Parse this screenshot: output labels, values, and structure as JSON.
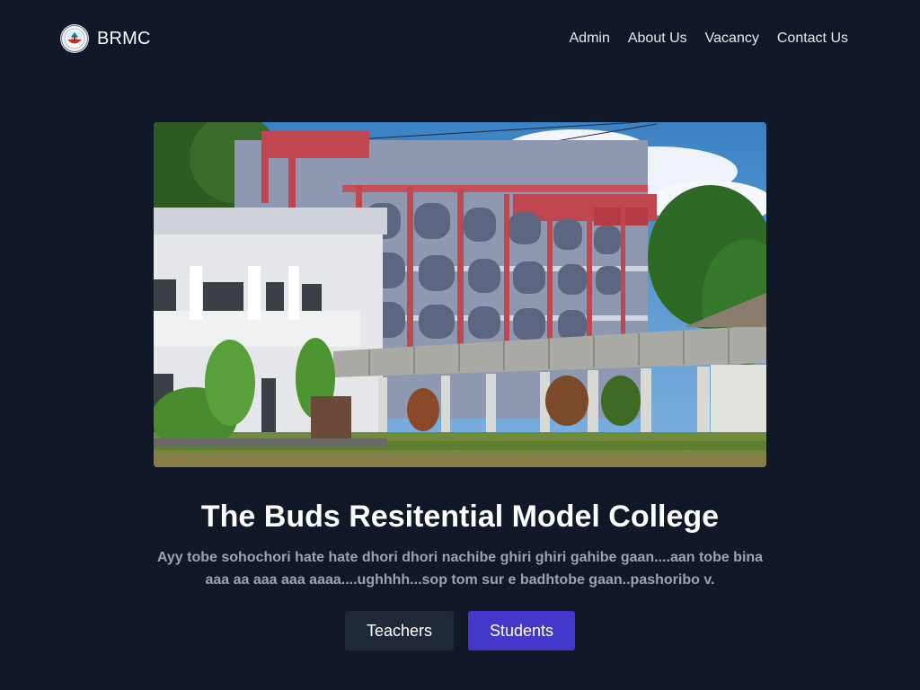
{
  "header": {
    "brand": "BRMC",
    "logo_icon": "college-seal-logo",
    "nav": [
      {
        "label": "Admin"
      },
      {
        "label": "About Us"
      },
      {
        "label": "Vacancy"
      },
      {
        "label": "Contact Us"
      }
    ]
  },
  "hero": {
    "image_subject": "college-building-photo"
  },
  "main": {
    "title": "The Buds Resitential Model College",
    "description": "Ayy tobe sohochori hate hate dhori dhori nachibe ghiri ghiri gahibe gaan....aan tobe bina aaa aa aaa aaa aaaa....ughhhh...sop tom sur e badhtobe gaan..pashoribo v.",
    "buttons": {
      "secondary_label": "Teachers",
      "primary_label": "Students"
    }
  },
  "colors": {
    "background": "#111827",
    "primary_button": "#4338ca",
    "secondary_button": "#1f2937",
    "title_text": "#ffffff",
    "description_text": "#9ca3af"
  }
}
